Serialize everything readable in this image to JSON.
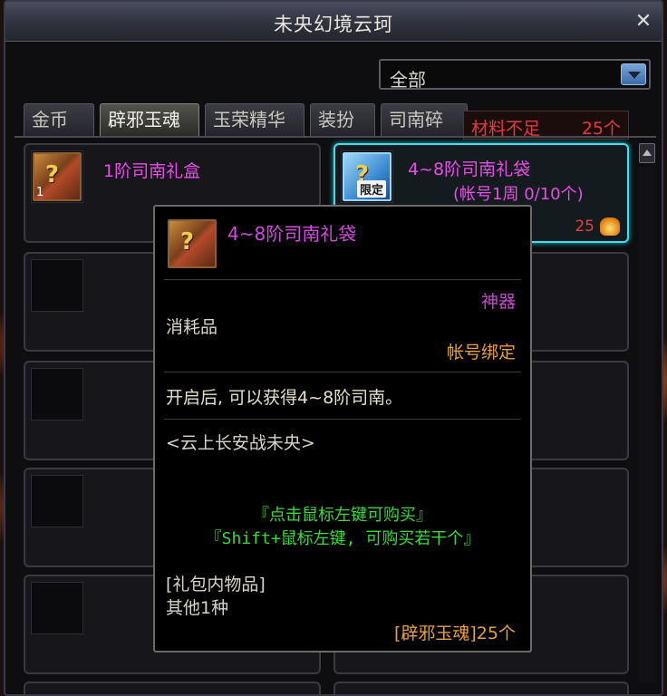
{
  "window": {
    "title": "未央幻境云珂",
    "close_glyph": "✕"
  },
  "filter": {
    "selected": "全部"
  },
  "tabs": [
    {
      "label": "金币",
      "active": false
    },
    {
      "label": "辟邪玉魂",
      "active": true
    },
    {
      "label": "玉荣精华",
      "active": false
    },
    {
      "label": "装扮",
      "active": false
    },
    {
      "label": "司南碎",
      "active": false
    }
  ],
  "warning": {
    "label": "材料不足",
    "count": "25个"
  },
  "items": [
    {
      "name": "1阶司南礼盒",
      "quantity": "1",
      "selected": false
    },
    {
      "name": "4~8阶司南礼袋",
      "limit": "(帐号1周 0/10个)",
      "limited_badge": "限定",
      "price": "25",
      "selected": true
    }
  ],
  "tooltip": {
    "title": "4~8阶司南礼袋",
    "rarity": "神器",
    "type": "消耗品",
    "bind": "帐号绑定",
    "description": "开启后, 可以获得4~8阶司南。",
    "source": "<云上长安战未央>",
    "hint_click": "『点击鼠标左键可购买』",
    "hint_shift": "『Shift+鼠标左键, 可购买若干个』",
    "contents_header": "[礼包内物品]",
    "contents_value": "其他1种",
    "cost": "[辟邪玉魂]25个"
  },
  "colors": {
    "item_name": "#e64ee6",
    "warning": "#e63a3a",
    "hint": "#3ad83a",
    "bind": "#e8a040",
    "selected_border": "#3ce0f0"
  },
  "icons": [
    "close-icon",
    "chevron-down-icon",
    "gift-box-icon",
    "currency-icon",
    "scroll-up-icon"
  ]
}
